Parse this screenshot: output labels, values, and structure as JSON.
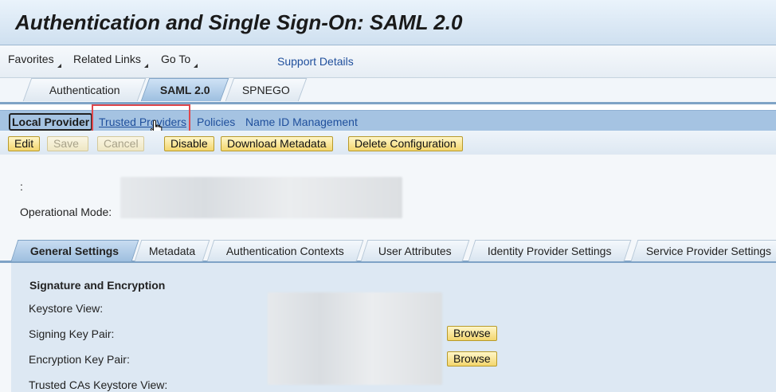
{
  "header": {
    "title": "Authentication and Single Sign-On: SAML 2.0"
  },
  "menu": {
    "items": [
      "Favorites",
      "Related Links",
      "Go To"
    ],
    "support_link": "Support Details"
  },
  "top_tabs": [
    "Authentication",
    "SAML 2.0",
    "SPNEGO"
  ],
  "top_tabs_active": "SAML 2.0",
  "subnav": {
    "items": [
      "Local Provider",
      "Trusted Providers",
      "Policies",
      "Name ID Management"
    ],
    "active": "Local Provider",
    "hovered": "Trusted Providers"
  },
  "actions": {
    "edit": "Edit",
    "save": "Save",
    "cancel": "Cancel",
    "disable": "Disable",
    "download_metadata": "Download Metadata",
    "delete_configuration": "Delete Configuration"
  },
  "info": {
    "first_label": ":",
    "operational_mode_label": "Operational Mode:"
  },
  "lower_tabs": [
    "General Settings",
    "Metadata",
    "Authentication Contexts",
    "User Attributes",
    "Identity Provider Settings",
    "Service Provider Settings"
  ],
  "lower_tabs_active": "General Settings",
  "general_settings": {
    "section_title": "Signature and Encryption",
    "keystore_view_label": "Keystore View:",
    "signing_key_pair_label": "Signing Key Pair:",
    "encryption_key_pair_label": "Encryption Key Pair:",
    "trusted_cas_label": "Trusted CAs Keystore View:",
    "browse_label": "Browse"
  },
  "colors": {
    "link": "#1f4f9c",
    "highlight": "#e0474c",
    "button": "#f3d66e",
    "subnav_bg": "#a5c3e2"
  },
  "icons": [
    "hand-cursor-icon",
    "dropdown-arrow-icon"
  ]
}
